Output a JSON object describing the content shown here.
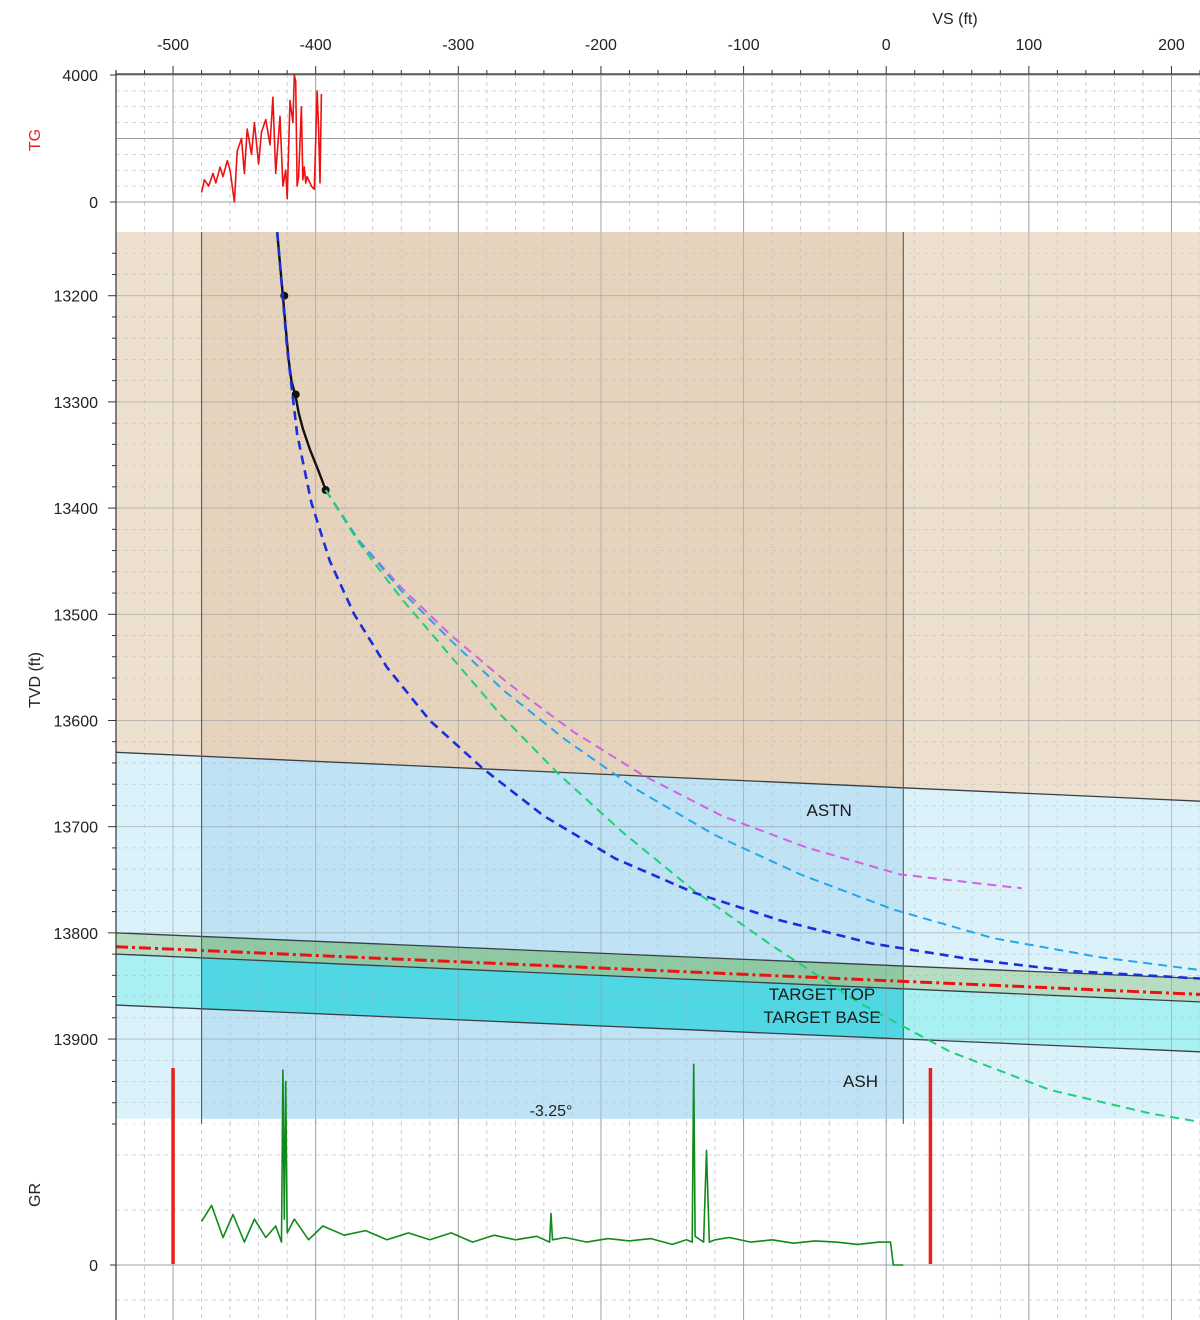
{
  "chart_data": {
    "type": "line",
    "x_axis": {
      "label": "VS (ft)",
      "range": [
        -540,
        220
      ],
      "ticks": [
        -500,
        -400,
        -300,
        -200,
        -100,
        0,
        100,
        200
      ],
      "tick_labels": [
        "-500",
        "-400",
        "-300",
        "-200",
        "-100",
        "0",
        "100",
        "200"
      ]
    },
    "panels": [
      {
        "id": "tg",
        "label": "TG",
        "label_color": "#e8211b",
        "range": [
          0,
          4000
        ],
        "ticks": [
          0,
          4000
        ],
        "tick_labels": [
          "0",
          "4000"
        ],
        "series": [
          {
            "color": "#ee1111",
            "x": [
              -480,
              -478,
              -475,
              -472,
              -470,
              -467,
              -465,
              -462,
              -460,
              -457,
              -455,
              -452,
              -450,
              -448,
              -445,
              -443,
              -440,
              -438,
              -435,
              -432,
              -430,
              -428,
              -425,
              -423,
              -421,
              -420,
              -418,
              -416,
              -415,
              -414,
              -413,
              -412,
              -410,
              -409,
              -408,
              -407,
              -406,
              -405,
              -403,
              -401,
              -399,
              -398,
              -397,
              -396
            ],
            "y": [
              300,
              700,
              500,
              900,
              600,
              1100,
              800,
              1300,
              1000,
              0,
              1600,
              2000,
              900,
              2300,
              1500,
              2500,
              1200,
              2200,
              2600,
              1800,
              3300,
              900,
              2700,
              500,
              1000,
              100,
              3200,
              2500,
              4000,
              3800,
              500,
              800,
              3000,
              700,
              1100,
              600,
              800,
              700,
              500,
              400,
              3500,
              2400,
              600,
              3400
            ]
          }
        ]
      },
      {
        "id": "tvd",
        "label": "TVD (ft)",
        "range": [
          13140,
          13980
        ],
        "ticks": [
          13200,
          13300,
          13400,
          13500,
          13600,
          13700,
          13800,
          13900
        ],
        "tick_labels": [
          "13200",
          "13300",
          "13400",
          "13500",
          "13600",
          "13700",
          "13800",
          "13900"
        ],
        "shaded_window_x": [
          -480,
          12
        ],
        "formations": [
          {
            "name": "ASTN",
            "top_x": [
              -540,
              220
            ],
            "top_y": [
              13630,
              13676
            ],
            "fill_above": "#ede0cf",
            "fill_above_window": "#e6d3bd"
          },
          {
            "name": "TARGET TOP",
            "top_x": [
              -540,
              220
            ],
            "top_y": [
              13800,
              13843
            ],
            "fill_above": "#dbf2fb",
            "fill_above_window": "#bfe2f4"
          },
          {
            "name": "TARGET BASE",
            "top_x": [
              -540,
              220
            ],
            "top_y": [
              13820,
              13865
            ],
            "fill_above": "#b6dcc2",
            "fill_above_window": "#8fc9a4"
          },
          {
            "name": "ASH",
            "top_x": [
              -540,
              220
            ],
            "top_y": [
              13868,
              13912
            ],
            "fill_above": "#a9f0f3",
            "fill_above_window": "#4fd8e4"
          },
          {
            "name": "",
            "top_x": [
              -540,
              220
            ],
            "top_y": [
              13975,
              13975
            ],
            "fill_above": "#dbf2fb",
            "fill_above_window": "#bfe2f4"
          }
        ],
        "formation_labels": [
          {
            "name": "ASTN",
            "x": -40,
            "y": 13690
          },
          {
            "name": "TARGET TOP",
            "x": -45,
            "y": 13863
          },
          {
            "name": "TARGET BASE",
            "x": -45,
            "y": 13885
          },
          {
            "name": "ASH",
            "x": -18,
            "y": 13945
          }
        ],
        "series": [
          {
            "name": "",
            "style": "solid",
            "color": "#111111",
            "x": [
              -427,
              -425,
              -423,
              -421,
              -419,
              -417,
              -414,
              -412,
              -409,
              -404,
              -398,
              -393
            ],
            "y": [
              13140,
              13170,
              13200,
              13230,
              13260,
              13280,
              13295,
              13310,
              13325,
              13345,
              13365,
              13383
            ],
            "markers_x": [
              -422,
              -414,
              -393
            ],
            "markers_y": [
              13200,
              13293,
              13383
            ]
          },
          {
            "name": "",
            "style": "dashed",
            "color": "#1a2fd9",
            "x": [
              -427,
              -420,
              -413,
              -403,
              -390,
              -373,
              -350,
              -320,
              -283,
              -240,
              -190,
              -135,
              -75,
              -10,
              60,
              130,
              220
            ],
            "y": [
              13140,
              13250,
              13330,
              13395,
              13450,
              13500,
              13550,
              13600,
              13645,
              13690,
              13730,
              13762,
              13788,
              13810,
              13825,
              13836,
              13843
            ]
          },
          {
            "name": "",
            "style": "dashed",
            "color": "#d063e0",
            "x": [
              -393,
              -370,
              -340,
              -305,
              -265,
              -220,
              -170,
              -115,
              -55,
              10,
              95
            ],
            "y": [
              13383,
              13430,
              13475,
              13520,
              13565,
              13610,
              13652,
              13690,
              13720,
              13745,
              13758
            ]
          },
          {
            "name": "",
            "style": "dashed",
            "color": "#25a6ea",
            "x": [
              -393,
              -370,
              -340,
              -305,
              -268,
              -225,
              -175,
              -120,
              -60,
              5,
              75,
              150,
              220
            ],
            "y": [
              13383,
              13430,
              13478,
              13525,
              13572,
              13618,
              13665,
              13708,
              13745,
              13778,
              13805,
              13823,
              13835
            ]
          },
          {
            "name": "",
            "style": "dashed",
            "color": "#1ecf79",
            "x": [
              -393,
              -370,
              -340,
              -305,
              -270,
              -230,
              -185,
              -135,
              -80,
              -20,
              45,
              115,
              185,
              220
            ],
            "y": [
              13383,
              13432,
              13485,
              13540,
              13595,
              13650,
              13705,
              13760,
              13812,
              13865,
              13912,
              13948,
              13970,
              13978
            ]
          },
          {
            "name": "",
            "style": "dash-dot",
            "color": "#ee1111",
            "x": [
              -540,
              220
            ],
            "y": [
              13813,
              13858
            ]
          }
        ]
      },
      {
        "id": "gr",
        "label": "GR",
        "range": [
          -30,
          175
        ],
        "ticks": [
          0
        ],
        "tick_labels": [
          "0"
        ],
        "annotation": {
          "text": "-3.25°",
          "x": -235,
          "y": 130
        },
        "markers": [
          {
            "x": -500,
            "color": "#e8211b"
          },
          {
            "x": 31,
            "color": "#e8211b"
          }
        ],
        "series": [
          {
            "color": "#0f8a1b",
            "x": [
              -480,
              -473,
              -465,
              -458,
              -450,
              -443,
              -435,
              -428,
              -424,
              -423,
              -422,
              -421,
              -420,
              -415,
              -405,
              -395,
              -380,
              -365,
              -350,
              -335,
              -320,
              -305,
              -290,
              -275,
              -260,
              -245,
              -236,
              -235,
              -234,
              -225,
              -210,
              -195,
              -180,
              -165,
              -150,
              -140,
              -136,
              -135,
              -134,
              -128,
              -126,
              -125,
              -124,
              -120,
              -110,
              -95,
              -80,
              -65,
              -50,
              -35,
              -20,
              -5,
              3,
              5,
              6,
              10,
              12
            ],
            "y": [
              38,
              52,
              24,
              44,
              20,
              40,
              24,
              34,
              20,
              170,
              40,
              160,
              28,
              40,
              22,
              34,
              26,
              30,
              22,
              28,
              22,
              28,
              20,
              26,
              22,
              25,
              20,
              45,
              22,
              24,
              20,
              23,
              21,
              23,
              18,
              22,
              20,
              175,
              25,
              20,
              100,
              60,
              20,
              22,
              24,
              20,
              22,
              19,
              21,
              20,
              18,
              20,
              20,
              0,
              0,
              0,
              0
            ]
          }
        ]
      }
    ]
  }
}
